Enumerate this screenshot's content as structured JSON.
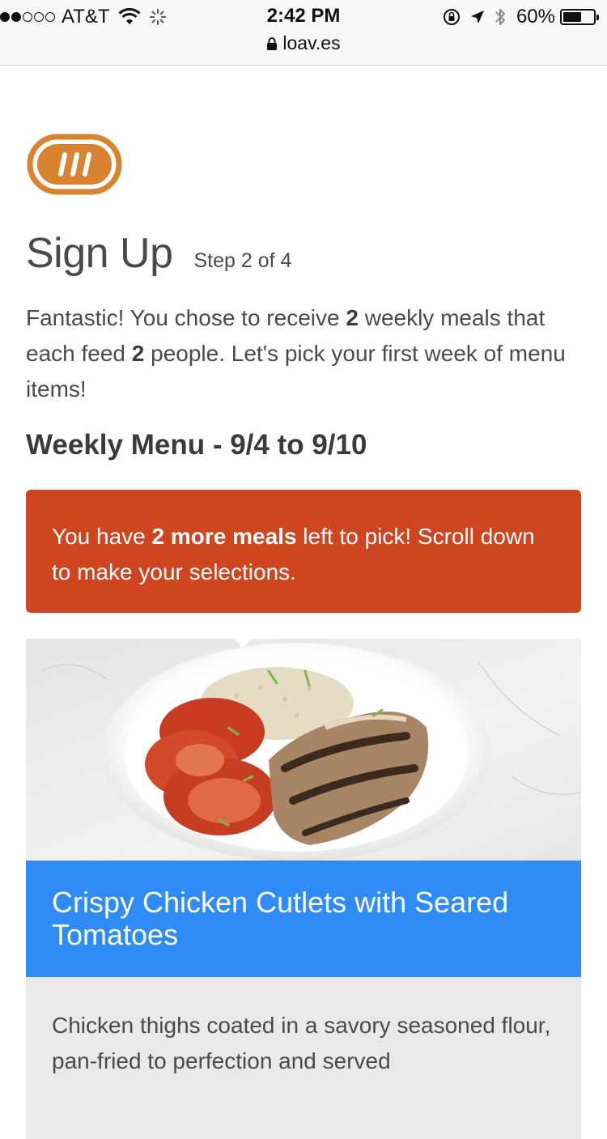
{
  "status_bar": {
    "carrier": "AT&T",
    "time": "2:42 PM",
    "battery": "60%",
    "battery_level": 0.6,
    "signal_bars_filled": 2,
    "signal_bars_total": 5,
    "url": "loav.es",
    "icons": [
      "wifi-icon",
      "activity-spinner-icon",
      "orientation-lock-icon",
      "location-arrow-icon",
      "bluetooth-icon",
      "battery-icon",
      "lock-icon"
    ]
  },
  "brand": {
    "logo_icon": "loaves-logo-icon",
    "color": "#d98330"
  },
  "page": {
    "title": "Sign Up",
    "step": "Step 2 of 4",
    "intro": {
      "part1": "Fantastic! You chose to receive ",
      "meals": "2",
      "part2": " weekly meals that each feed ",
      "people": "2",
      "part3": " people. Let's pick your first week of menu items!"
    },
    "menu_heading": "Weekly Menu - 9/4 to 9/10"
  },
  "alert": {
    "part1": "You have ",
    "bold": "2 more meals",
    "part2": " left to pick! Scroll down to make your selections.",
    "color": "#cf4520"
  },
  "meals": [
    {
      "title": "Crispy Chicken Cutlets with Seared Tomatoes",
      "description": "Chicken thighs coated in a savory seasoned flour, pan-fried to perfection and served",
      "title_bg": "#2f8cf7"
    }
  ]
}
